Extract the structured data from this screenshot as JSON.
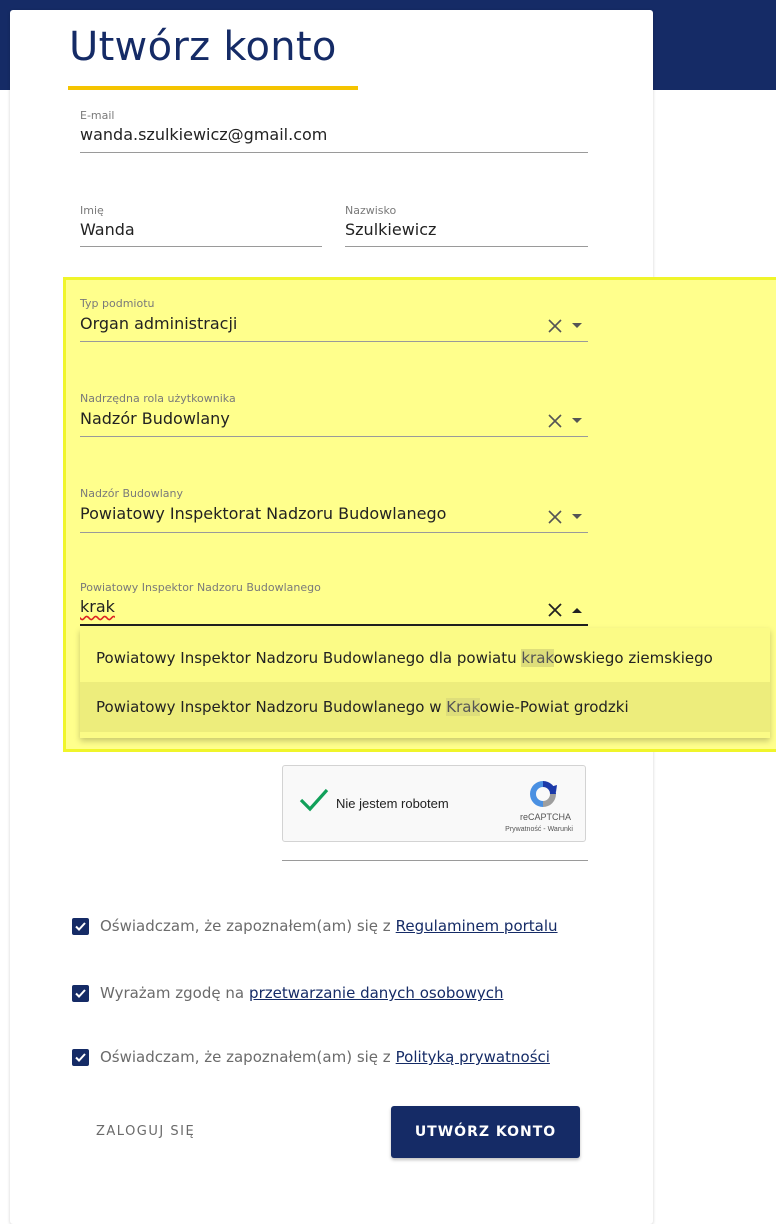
{
  "form": {
    "title": "Utwórz konto",
    "email": {
      "label": "E-mail",
      "value": "wanda.szulkiewicz@gmail.com"
    },
    "first_name": {
      "label": "Imię",
      "value": "Wanda"
    },
    "last_name": {
      "label": "Nazwisko",
      "value": "Szulkiewicz"
    },
    "entity_type": {
      "label": "Typ podmiotu",
      "value": "Organ administracji"
    },
    "parent_role": {
      "label": "Nadrzędna rola użytkownika",
      "value": "Nadzór Budowlany"
    },
    "supervision": {
      "label": "Nadzór Budowlany",
      "value": "Powiatowy Inspektorat Nadzoru Budowlanego"
    },
    "inspector": {
      "label": "Powiatowy Inspektor Nadzoru Budowlanego",
      "value": "krak"
    }
  },
  "autocomplete": {
    "options": [
      {
        "before": "Powiatowy Inspektor Nadzoru Budowlanego dla powiatu ",
        "match": "krak",
        "after": "owskiego ziemskiego"
      },
      {
        "before": "Powiatowy Inspektor Nadzoru Budowlanego w ",
        "match": "Krak",
        "after": "owie-Powiat grodzki"
      }
    ]
  },
  "captcha": {
    "label": "Nie jestem robotem",
    "brand": "reCAPTCHA",
    "privacy": "Prywatność",
    "separator": " - ",
    "terms": "Warunki"
  },
  "consents": [
    {
      "text": "Oświadczam, że zapoznałem(am) się z",
      "link": "Regulaminem portalu",
      "checked": true
    },
    {
      "text": "Wyrażam zgodę na",
      "link": "przetwarzanie danych osobowych",
      "checked": true
    },
    {
      "text": "Oświadczam, że zapoznałem(am) się z",
      "link": "Polityką prywatności",
      "checked": true
    }
  ],
  "actions": {
    "login": "ZALOGUJ SIĘ",
    "create": "UTWÓRZ KONTO"
  },
  "colors": {
    "primary": "#152b66",
    "accent": "#f5c400",
    "highlight": "#ffff8c"
  }
}
